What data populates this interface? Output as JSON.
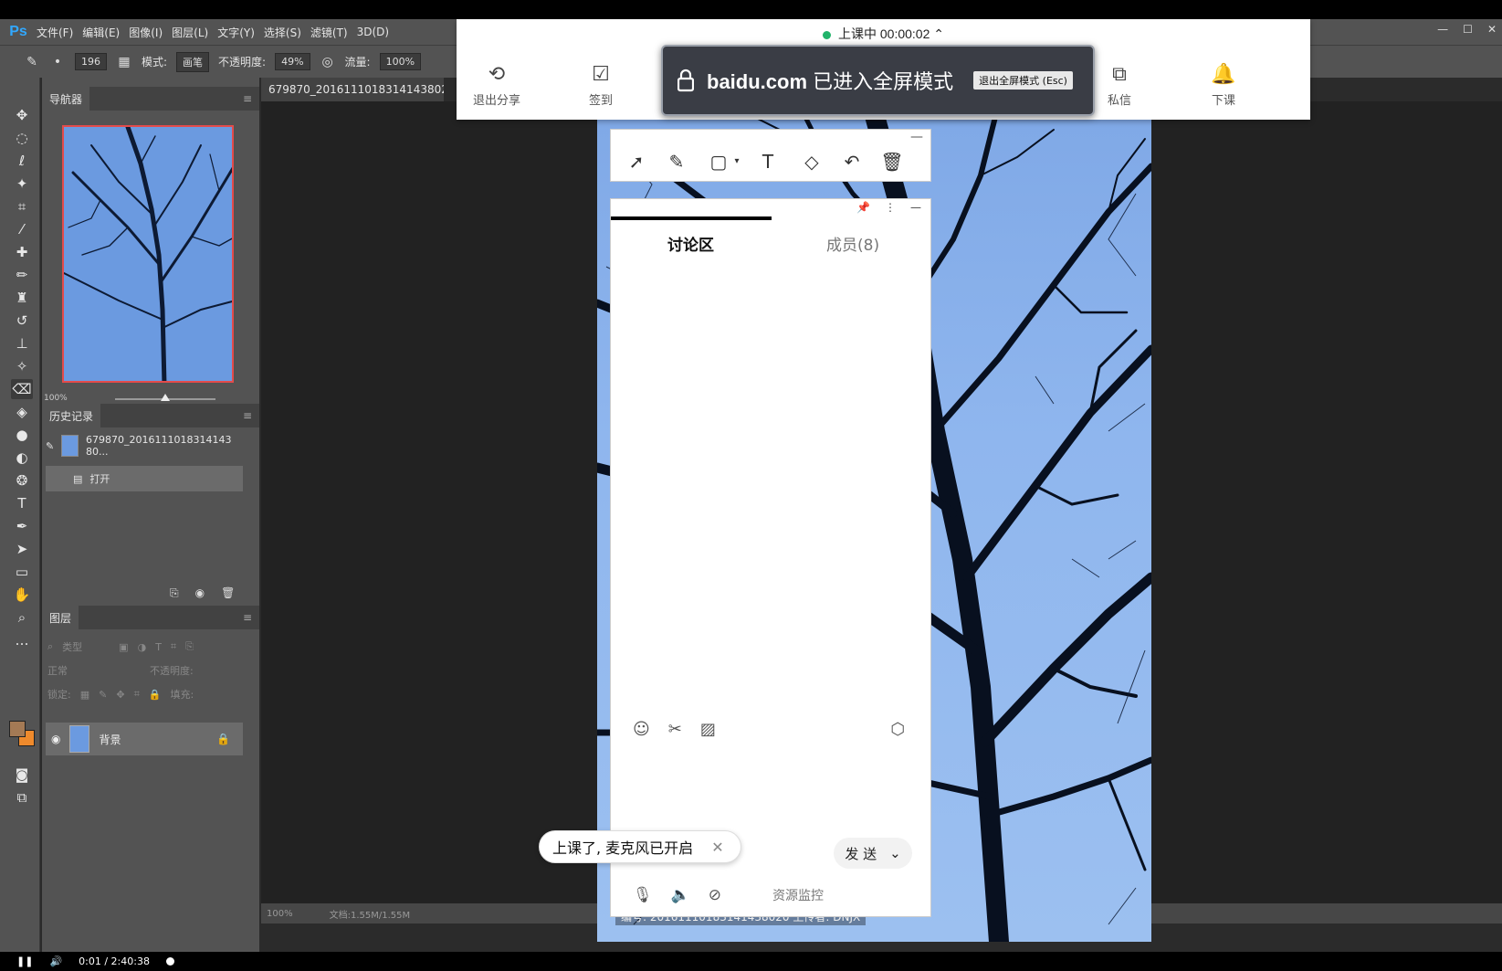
{
  "ps": {
    "logo": "Ps",
    "menu": [
      "文件(F)",
      "编辑(E)",
      "图像(I)",
      "图层(L)",
      "文字(Y)",
      "选择(S)",
      "滤镜(T)",
      "3D(D)"
    ],
    "options": {
      "brush_size": "196",
      "mode_label": "模式:",
      "mode_value": "画笔",
      "opacity_label": "不透明度:",
      "opacity_value": "49%",
      "flow_label": "流量:",
      "flow_value": "100%"
    },
    "document_tab": "679870_20161110183141438020_",
    "navigator": {
      "title": "导航器",
      "zoom": "100%"
    },
    "history": {
      "title": "历史记录",
      "snapshot": "679870_2016111018314143​80...",
      "items": [
        "打开"
      ]
    },
    "layers": {
      "title": "图层",
      "filter_placeholder": "类型",
      "blend_mode": "正常",
      "opacity_label": "不透明度:",
      "lock_label": "锁定:",
      "fill_label": "填充:",
      "layer_name": "背景"
    },
    "status": {
      "zoom": "100%",
      "doc": "文档:1.55M/1.55M"
    }
  },
  "photo": {
    "caption": "编号: 20161110183141438020 上传者: DNJX"
  },
  "classroom": {
    "status": "上课中 00:00:02",
    "status_color": "#21b36a",
    "buttons": [
      {
        "label": "退出分享",
        "icon": "exit-share-icon"
      },
      {
        "label": "签到",
        "icon": "checkin-icon"
      },
      {
        "label": "私信",
        "icon": "message-icon"
      },
      {
        "label": "下课",
        "icon": "end-class-icon"
      }
    ],
    "fullscreen": {
      "domain": "baidu.com",
      "text": "已进入全屏模式",
      "exit_label": "退出全屏模式 (Esc)"
    },
    "chat": {
      "tab_discuss": "讨论区",
      "tab_members": "成员(8)",
      "send_label": "发 送",
      "resource_monitor": "资源监控"
    },
    "toast": "上课了, 麦克风已开启"
  },
  "player": {
    "time": "0:01 / 2:40:38"
  }
}
